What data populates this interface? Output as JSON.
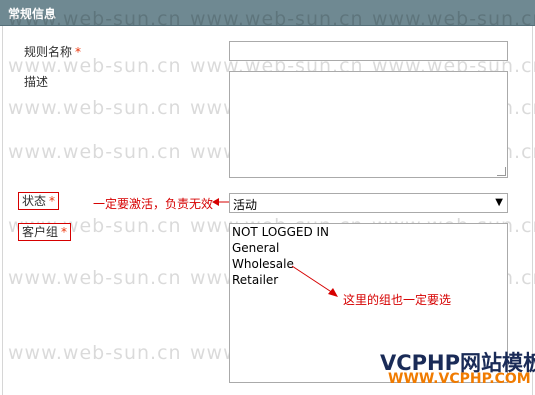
{
  "header": {
    "title": "常规信息"
  },
  "form": {
    "rule_name": {
      "label": "规则名称",
      "required": "*",
      "value": ""
    },
    "description": {
      "label": "描述",
      "value": ""
    },
    "status": {
      "label": "状态",
      "required": "*",
      "selected": "活动"
    },
    "customer_group": {
      "label": "客户组",
      "required": "*",
      "options": [
        "NOT LOGGED IN",
        "General",
        "Wholesale",
        "Retailer"
      ]
    }
  },
  "annotations": {
    "status_note": "一定要激活，负责无效",
    "group_note": "这里的组也一定要选"
  },
  "watermark": {
    "text": "www.web-sun.cn"
  },
  "branding": {
    "name": "VCPHP网站模板",
    "url": "WWW.VCPHP.COM"
  },
  "colors": {
    "header_bg": "#6f8992",
    "annotation": "#d60000",
    "required": "#eb340a"
  }
}
